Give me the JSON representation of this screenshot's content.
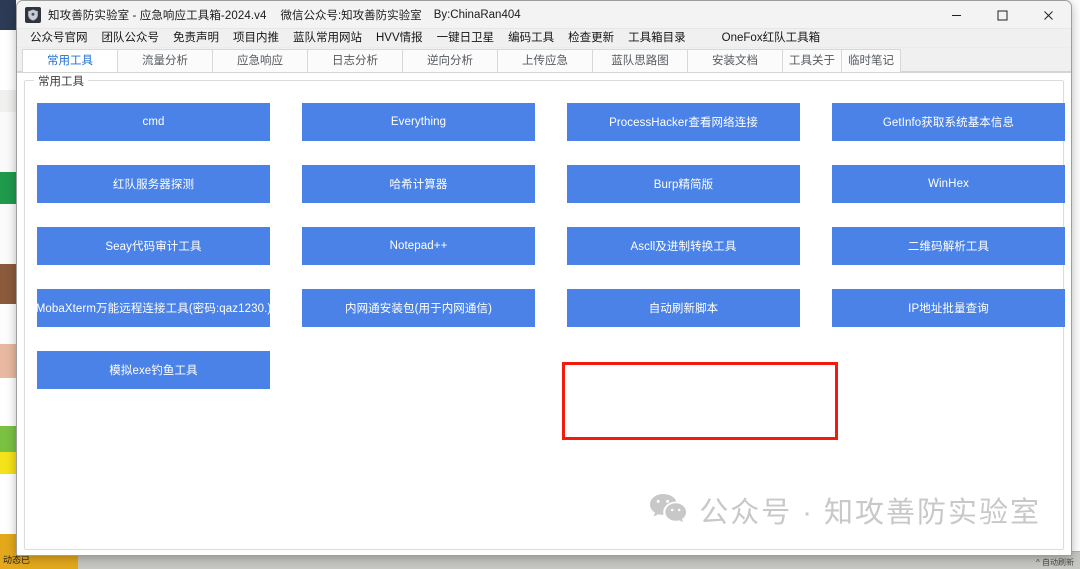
{
  "window": {
    "title": "知攻善防实验室 - 应急响应工具箱-2024.v4",
    "subtitle": "微信公众号:知攻善防实验室",
    "author": "By:ChinaRan404",
    "icon": "shield-icon",
    "controls": {
      "minimize": "minimize-icon",
      "maximize": "maximize-icon",
      "close": "close-icon"
    }
  },
  "menubar": {
    "items": [
      {
        "label": "公众号官网"
      },
      {
        "label": "团队公众号"
      },
      {
        "label": "免责声明"
      },
      {
        "label": "项目内推"
      },
      {
        "label": "蓝队常用网站"
      },
      {
        "label": "HVV情报"
      },
      {
        "label": "一键日卫星"
      },
      {
        "label": "编码工具"
      },
      {
        "label": "检查更新"
      },
      {
        "label": "工具箱目录"
      },
      {
        "label": "OneFox红队工具箱"
      }
    ]
  },
  "tabs": [
    {
      "label": "常用工具",
      "active": true,
      "width": "wide"
    },
    {
      "label": "流量分析",
      "active": false,
      "width": "wide"
    },
    {
      "label": "应急响应",
      "active": false,
      "width": "wide"
    },
    {
      "label": "日志分析",
      "active": false,
      "width": "wide"
    },
    {
      "label": "逆向分析",
      "active": false,
      "width": "wide"
    },
    {
      "label": "上传应急",
      "active": false,
      "width": "wide"
    },
    {
      "label": "蓝队思路图",
      "active": false,
      "width": "wide"
    },
    {
      "label": "安装文档",
      "active": false,
      "width": "wide"
    },
    {
      "label": "工具关于",
      "active": false,
      "width": "narrow"
    },
    {
      "label": "临时笔记",
      "active": false,
      "width": "narrow"
    }
  ],
  "panel": {
    "group_label": "常用工具",
    "buttons": [
      {
        "label": "cmd"
      },
      {
        "label": "Everything"
      },
      {
        "label": "ProcessHacker查看网络连接"
      },
      {
        "label": "GetInfo获取系统基本信息"
      },
      {
        "label": "红队服务器探测"
      },
      {
        "label": "哈希计算器"
      },
      {
        "label": "Burp精简版"
      },
      {
        "label": "WinHex"
      },
      {
        "label": "Seay代码审计工具"
      },
      {
        "label": "Notepad++"
      },
      {
        "label": "Ascll及进制转换工具"
      },
      {
        "label": "二维码解析工具"
      },
      {
        "label": "MobaXterm万能远程连接工具(密码:qaz1230.)"
      },
      {
        "label": "内网通安装包(用于内网通信)"
      },
      {
        "label": "自动刷新脚本"
      },
      {
        "label": "IP地址批量查询"
      },
      {
        "label": "模拟exe钓鱼工具"
      }
    ],
    "highlighted_button": "自动刷新脚本"
  },
  "watermark": {
    "logo": "wechat-icon",
    "text": "公众号 · 知攻善防实验室"
  },
  "background": {
    "taskbar_item": "动态已",
    "tray_text": "^ 自动刷新"
  },
  "colors": {
    "button_blue": "#4a82e8",
    "highlight_red": "#f41b0e",
    "active_tab_text": "#1f6fd0",
    "watermark_gray": "#c8c8c8"
  }
}
